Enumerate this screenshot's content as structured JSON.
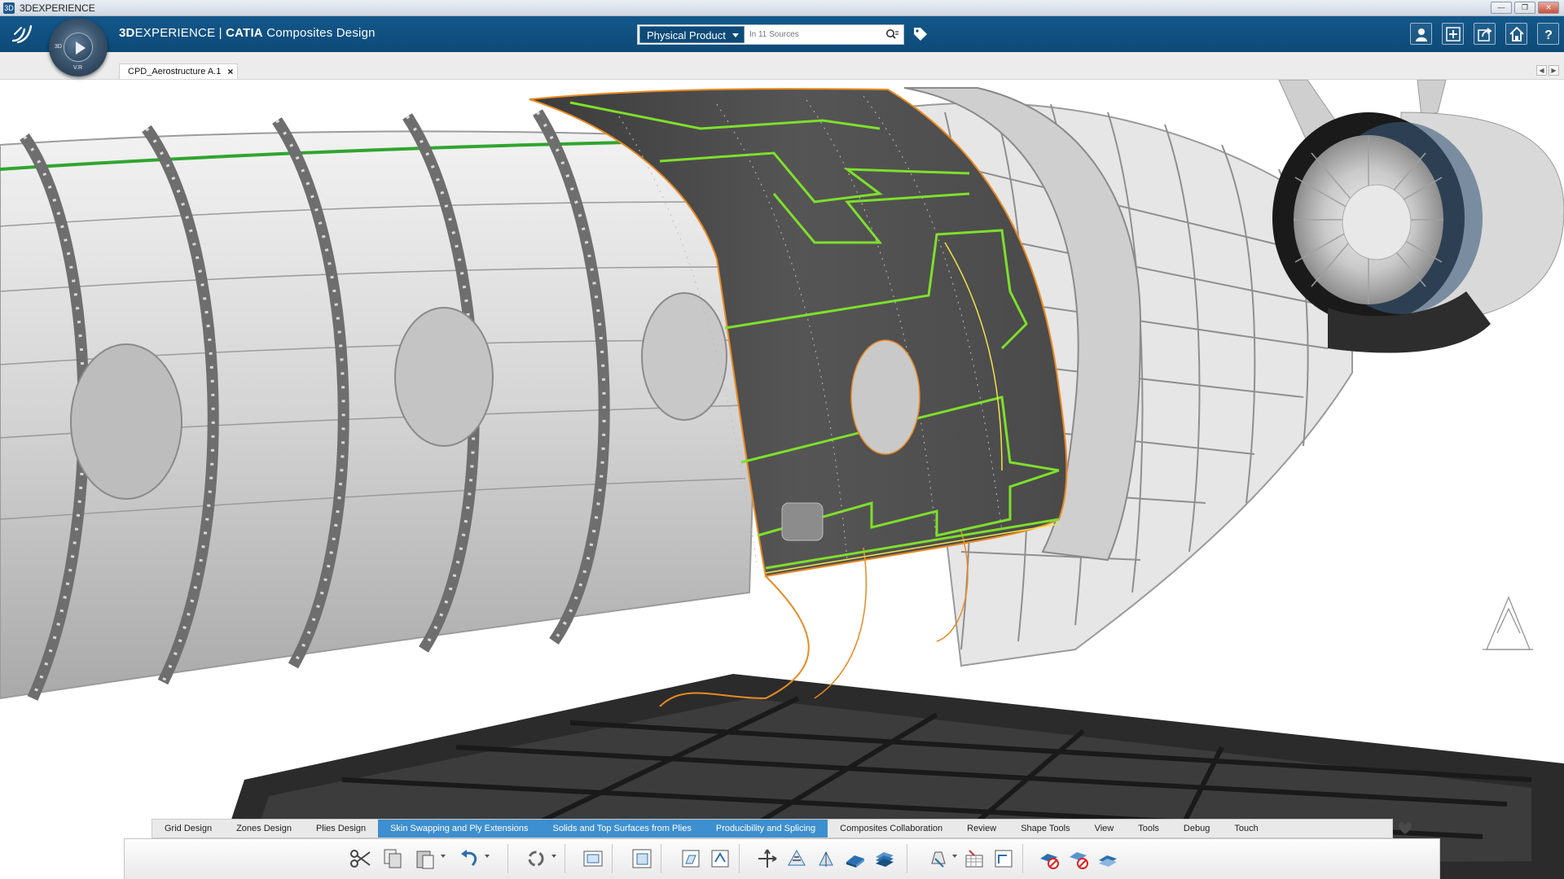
{
  "window": {
    "title": "3DEXPERIENCE"
  },
  "header": {
    "brand_prefix": "3D",
    "brand_rest": "EXPERIENCE",
    "separator": " | ",
    "product": "CATIA",
    "app": " Composites Design",
    "compass_labels": {
      "left": "3D",
      "bottom": "V.R"
    }
  },
  "search": {
    "scope": "Physical Product",
    "placeholder": "In 11 Sources"
  },
  "document_tab": {
    "label": "CPD_Aerostructure A.1",
    "close": "×"
  },
  "action_bar": {
    "tabs": [
      {
        "label": "Grid Design",
        "active": false
      },
      {
        "label": "Zones Design",
        "active": false
      },
      {
        "label": "Plies Design",
        "active": false
      },
      {
        "label": "Skin Swapping and Ply Extensions",
        "active": true
      },
      {
        "label": "Solids and Top Surfaces from Plies",
        "active": true
      },
      {
        "label": "Producibility and Splicing",
        "active": true
      },
      {
        "label": "Composites Collaboration",
        "active": false
      },
      {
        "label": "Review",
        "active": false
      },
      {
        "label": "Shape Tools",
        "active": false
      },
      {
        "label": "View",
        "active": false
      },
      {
        "label": "Tools",
        "active": false
      },
      {
        "label": "Debug",
        "active": false
      },
      {
        "label": "Touch",
        "active": false
      }
    ]
  },
  "toolbar_icons": [
    "cut-icon",
    "copy-icon",
    "paste-icon",
    "undo-icon",
    "update-icon",
    "grid-panel-icon",
    "zone-panel-icon",
    "ply-table-icon",
    "ply-explorer-icon",
    "rosette-icon",
    "fiber-simulation-icon",
    "flattening-icon",
    "solid-from-plies-icon",
    "top-surface-icon",
    "material-excess-icon",
    "laser-projection-icon",
    "core-sample-icon",
    "splice-icon",
    "dart-icon",
    "ply-extension-icon"
  ],
  "colors": {
    "header_bg": "#0d4a78",
    "active_tab": "#3d8fcf",
    "ply_green": "#7ee02a",
    "ply_orange": "#e98a22",
    "skin_dark": "#4a4a4a"
  }
}
